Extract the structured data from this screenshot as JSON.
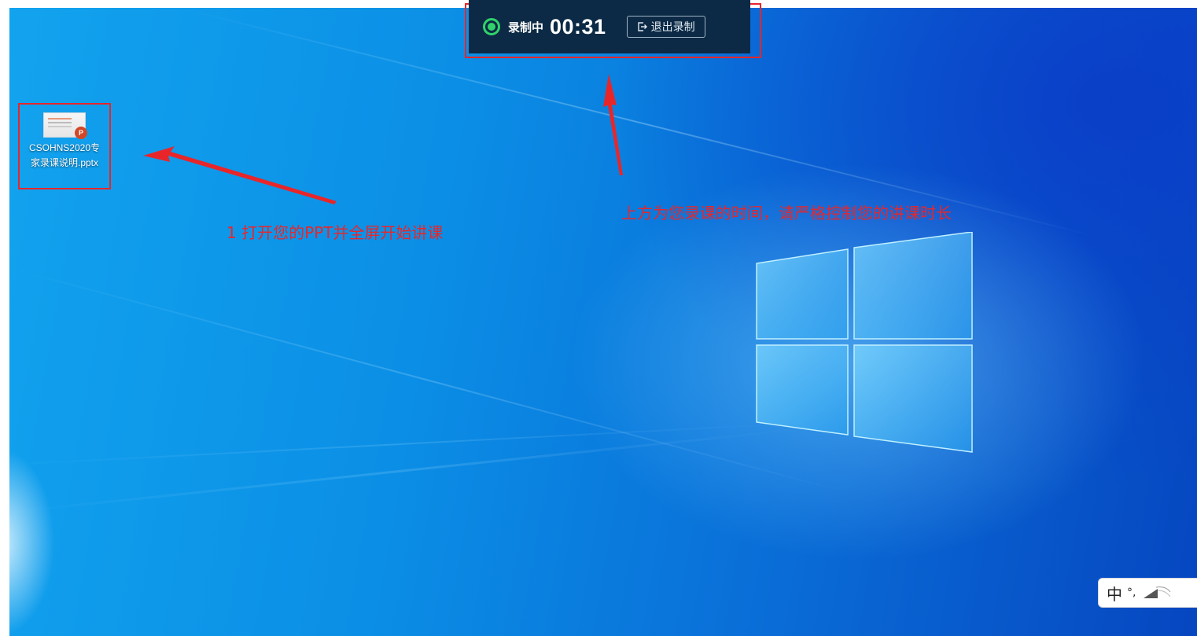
{
  "desktop": {
    "icon": {
      "file_name": "CSOHNS2020专家录课说明.pptx",
      "badge": "P"
    }
  },
  "recorder": {
    "status": "录制中",
    "elapsed": "00:31",
    "exit_label": "退出录制"
  },
  "annotations": {
    "step1": "1 打开您的PPT并全屏开始讲课",
    "timer_note": "上方为您录课的时间，请严格控制您的讲课时长"
  },
  "ime": {
    "mode": "中",
    "punctuation": "°,"
  },
  "colors": {
    "annotation": "#e8262a",
    "recorder_bg": "#0c2a45",
    "recording_dot": "#30d36a"
  }
}
